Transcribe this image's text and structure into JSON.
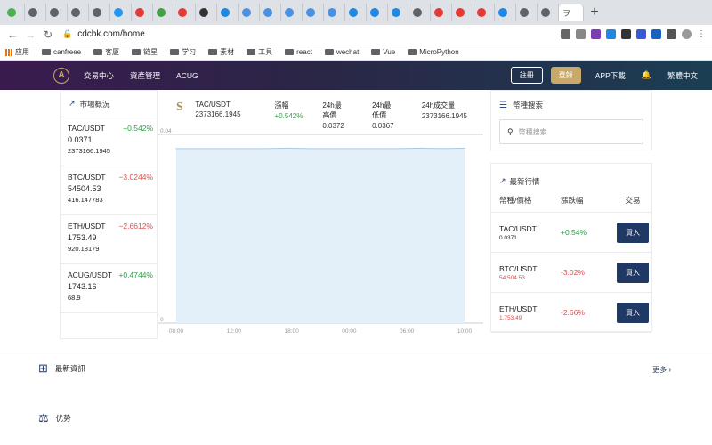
{
  "browser": {
    "tabs": [
      {
        "favicon_color": "#4caf50"
      },
      {
        "favicon_color": "#5f6368"
      },
      {
        "favicon_color": "#5f6368"
      },
      {
        "favicon_color": "#5f6368"
      },
      {
        "favicon_color": "#5f6368"
      },
      {
        "favicon_color": "#2196f3"
      },
      {
        "favicon_color": "#e53935"
      },
      {
        "favicon_color": "#43a047"
      },
      {
        "favicon_color": "#e53935"
      },
      {
        "favicon_color": "#333333"
      },
      {
        "favicon_color": "#1e88e5"
      },
      {
        "favicon_color": "#4a90e2"
      },
      {
        "favicon_color": "#4a90e2"
      },
      {
        "favicon_color": "#4a90e2"
      },
      {
        "favicon_color": "#4a90e2"
      },
      {
        "favicon_color": "#4a90e2"
      },
      {
        "favicon_color": "#1e88e5"
      },
      {
        "favicon_color": "#1e88e5"
      },
      {
        "favicon_color": "#1e88e5"
      },
      {
        "favicon_color": "#5f6368"
      },
      {
        "favicon_color": "#e53935"
      },
      {
        "favicon_color": "#e53935"
      },
      {
        "favicon_color": "#e53935"
      },
      {
        "favicon_color": "#1e88e5"
      },
      {
        "favicon_color": "#5f6368"
      },
      {
        "favicon_color": "#5f6368"
      }
    ],
    "active_tab_label": "ヲ",
    "url": "cdcbk.com/home",
    "bookmarks": [
      "应用",
      "canfreee",
      "客厦",
      "链星",
      "学习",
      "素材",
      "工具",
      "react",
      "wechat",
      "Vue",
      "MicroPython"
    ]
  },
  "header": {
    "logo_text": "A",
    "nav": [
      "交易中心",
      "資產管理",
      "ACUG"
    ],
    "register_label": "註冊",
    "login_label": "登錄",
    "app_download_label": "APP下載",
    "language_label": "繁體中文"
  },
  "market": {
    "title": "市場概況",
    "items": [
      {
        "pair": "TAC/USDT",
        "change": "+0.542%",
        "dir": "up",
        "price": "0.0371",
        "volume": "2373166.1945"
      },
      {
        "pair": "BTC/USDT",
        "change": "−3.0244%",
        "dir": "down",
        "price": "54504.53",
        "volume": "416.147783"
      },
      {
        "pair": "ETH/USDT",
        "change": "−2.6612%",
        "dir": "down",
        "price": "1753.49",
        "volume": "920.18179"
      },
      {
        "pair": "ACUG/USDT",
        "change": "+0.4744%",
        "dir": "up",
        "price": "1743.16",
        "volume": "68.9"
      }
    ]
  },
  "ticker": {
    "pair": "TAC/USDT",
    "volume_value": "2373166.1945",
    "change_label": "漲幅",
    "change_value": "+0.542%",
    "high_label": "24h最高價",
    "high_value": "0.0372",
    "low_label": "24h最低價",
    "low_value": "0.0367",
    "vol_label": "24h成交量",
    "vol_value": "2373166.1945"
  },
  "chart_data": {
    "type": "area",
    "x": [
      "08:00",
      "12:00",
      "16:00",
      "20:00",
      "00:00",
      "04:00",
      "08:00",
      "12:00",
      "16:00",
      "20:00",
      "00:00",
      "04:00",
      "08:00",
      "10:00"
    ],
    "y": [
      0.037,
      0.037,
      0.037,
      0.037,
      0.037,
      0.0371,
      0.037,
      0.037,
      0.037,
      0.037,
      0.037,
      0.0371,
      0.037,
      0.0371
    ],
    "x_tick_labels": [
      "08:00",
      "12:00",
      "18:00",
      "00:00",
      "06:00",
      "10:00"
    ],
    "y_tick_labels": [
      "0.04",
      "0"
    ],
    "ylim": [
      0,
      0.04
    ],
    "color": "#a9cbe6",
    "fill": "#e3f0f9",
    "grid": false
  },
  "search": {
    "title": "幣種搜索",
    "placeholder": "幣種搜索"
  },
  "latest": {
    "title": "最新行情",
    "headers": [
      "幣種/價格",
      "漲跌幅",
      "交易"
    ],
    "rows": [
      {
        "pair": "TAC/USDT",
        "price": "0.0371",
        "change": "+0.54%",
        "dir": "up",
        "action": "買入"
      },
      {
        "pair": "BTC/USDT",
        "price": "54,504.53",
        "change": "-3.02%",
        "dir": "down",
        "action": "買入"
      },
      {
        "pair": "ETH/USDT",
        "price": "1,753.49",
        "change": "-2.66%",
        "dir": "down",
        "action": "買入"
      }
    ]
  },
  "news": {
    "title": "最新資訊",
    "more_label": "更多"
  },
  "advantage": {
    "title": "优势"
  }
}
